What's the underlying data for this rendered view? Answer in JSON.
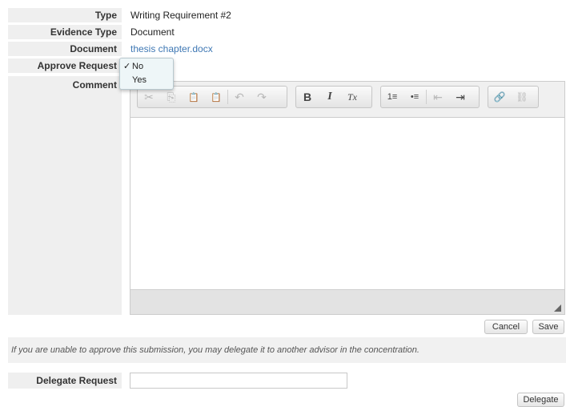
{
  "fields": {
    "type": {
      "label": "Type",
      "value": "Writing Requirement #2"
    },
    "evidence_type": {
      "label": "Evidence Type",
      "value": "Document"
    },
    "document": {
      "label": "Document",
      "value": "thesis chapter.docx"
    },
    "approve_request": {
      "label": "Approve Request",
      "options": [
        "No",
        "Yes"
      ],
      "selected": "No",
      "check_mark": "✓"
    },
    "comment": {
      "label": "Comment"
    }
  },
  "toolbar": {
    "cut": "✂",
    "copy": "⎘",
    "paste": "📋",
    "paste_text": "📋",
    "undo": "↶",
    "redo": "↷",
    "bold": "B",
    "italic": "I",
    "remove_format": "Tx",
    "numbered_list": "1≡",
    "bulleted_list": "•≡",
    "outdent": "⇤",
    "indent": "⇥",
    "link": "🔗",
    "unlink": "⛓"
  },
  "buttons": {
    "cancel": "Cancel",
    "save": "Save",
    "delegate": "Delegate"
  },
  "notice": "If you are unable to approve this submission, you may delegate it to another advisor in the concentration.",
  "delegate": {
    "label": "Delegate Request",
    "value": ""
  }
}
